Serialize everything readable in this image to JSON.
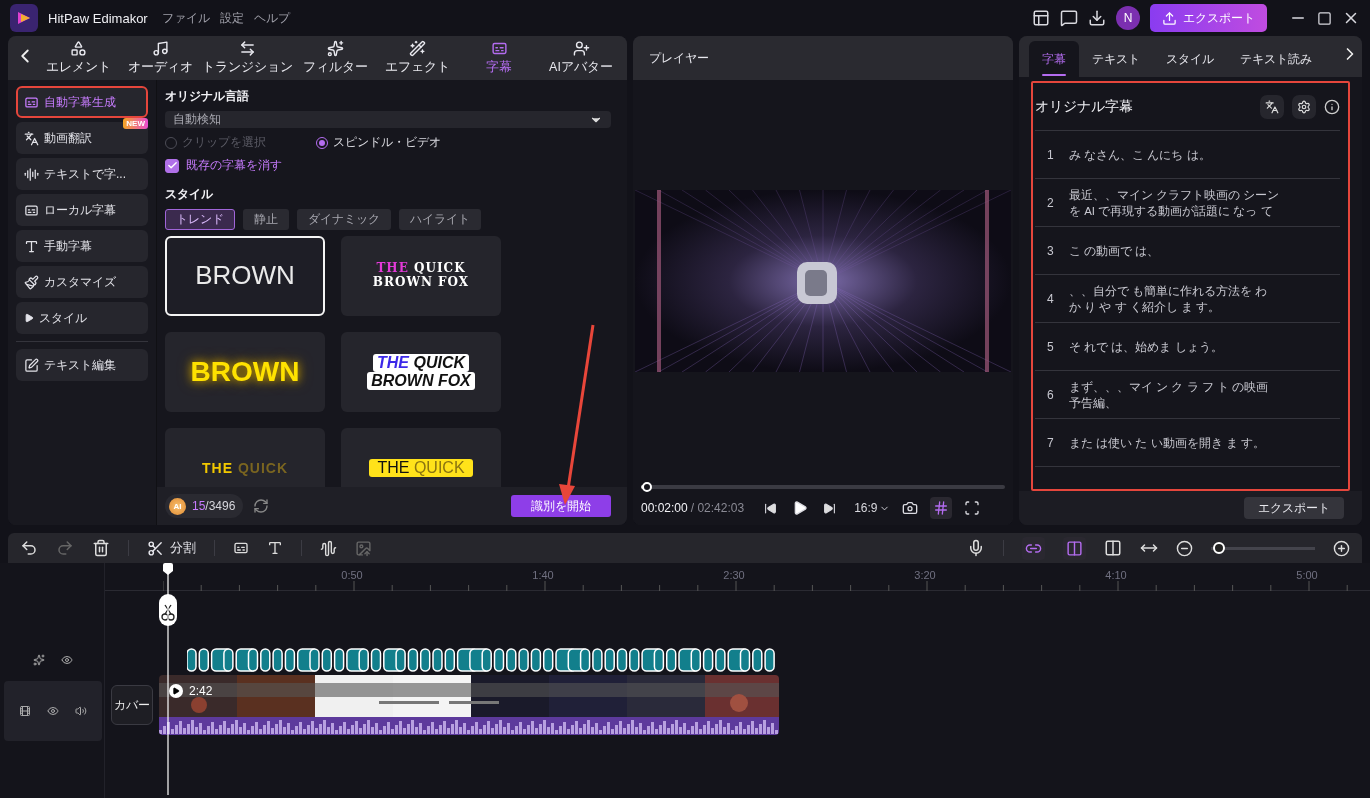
{
  "app": {
    "name": "HitPaw Edimakor",
    "menus": [
      "ファイル",
      "設定",
      "ヘルプ"
    ],
    "avatar": "N",
    "export_label": "エクスポート"
  },
  "categories": [
    {
      "label": "エレメント",
      "selected": false
    },
    {
      "label": "オーディオ",
      "selected": false
    },
    {
      "label": "トランジション",
      "selected": false
    },
    {
      "label": "フィルター",
      "selected": false
    },
    {
      "label": "エフェクト",
      "selected": false
    },
    {
      "label": "字幕",
      "selected": true
    },
    {
      "label": "AIアバター",
      "selected": false
    }
  ],
  "side_items": [
    {
      "label": "自動字幕生成",
      "selected": true,
      "highlighted": true,
      "kind": "item"
    },
    {
      "label": "動画翻訳",
      "selected": false,
      "highlighted": false,
      "kind": "item",
      "badge": "NEW"
    },
    {
      "label": "テキストで字...",
      "selected": false,
      "highlighted": false,
      "kind": "item"
    },
    {
      "label": "ローカル字幕",
      "selected": false,
      "highlighted": false,
      "kind": "item"
    },
    {
      "label": "手動字幕",
      "selected": false,
      "highlighted": false,
      "kind": "item"
    },
    {
      "label": "カスタマイズ",
      "selected": false,
      "highlighted": false,
      "kind": "item"
    },
    {
      "label": "スタイル",
      "selected": false,
      "highlighted": false,
      "kind": "group",
      "expanded": false
    },
    {
      "label": "テキスト編集",
      "selected": false,
      "highlighted": false,
      "kind": "item"
    }
  ],
  "language": {
    "label": "オリジナル言語",
    "value": "自動検知"
  },
  "scope_options": [
    {
      "label": "クリップを選択",
      "selected": false,
      "disabled": true
    },
    {
      "label": "スピンドル・ビデオ",
      "selected": true,
      "disabled": false
    }
  ],
  "clear_existing": {
    "label": "既存の字幕を消す",
    "checked": true
  },
  "style_section": {
    "title": "スタイル",
    "chips": [
      {
        "label": "トレンド",
        "selected": true
      },
      {
        "label": "静止",
        "selected": false
      },
      {
        "label": "ダイナミック",
        "selected": false
      },
      {
        "label": "ハイライト",
        "selected": false
      }
    ],
    "presets": [
      {
        "kind": "plain",
        "selected": true,
        "lines": [
          [
            {
              "text": "BROWN",
              "accent": false
            }
          ]
        ]
      },
      {
        "kind": "impact",
        "selected": false,
        "lines": [
          [
            {
              "text": "THE",
              "accent": true
            },
            {
              "text": "QUICK",
              "accent": false
            }
          ],
          [
            {
              "text": "BROWN FOX",
              "accent": false
            }
          ]
        ]
      },
      {
        "kind": "glow",
        "selected": false,
        "lines": [
          [
            {
              "text": "BROWN",
              "accent": false
            }
          ]
        ]
      },
      {
        "kind": "sticker",
        "selected": false,
        "lines": [
          [
            {
              "text": "THE",
              "accent": true
            },
            {
              "text": "QUICK",
              "accent": false
            }
          ],
          [
            {
              "text": "BROWN FOX",
              "accent": false
            }
          ]
        ]
      },
      {
        "kind": "gold",
        "selected": false,
        "lines": [
          [
            {
              "text": "THE",
              "accent": true
            },
            {
              "text": "QUICK",
              "accent": false
            }
          ]
        ]
      },
      {
        "kind": "banner",
        "selected": false,
        "lines": [
          [
            {
              "text": "THE",
              "accent": true
            },
            {
              "text": "QUICK",
              "accent": false
            }
          ]
        ]
      }
    ]
  },
  "credits": {
    "badge": "AI",
    "used": "15",
    "total": "/3496"
  },
  "start_button": "識別を開始",
  "player": {
    "title": "プレイヤー",
    "current": "00:02:00",
    "separator": "/",
    "total": "02:42:03",
    "ratio": "16:9",
    "level": 0.01
  },
  "subtitle_panel": {
    "tabs": [
      {
        "label": "字幕",
        "selected": true
      },
      {
        "label": "テキスト",
        "selected": false
      },
      {
        "label": "スタイル",
        "selected": false
      },
      {
        "label": "テキスト読み",
        "selected": false
      }
    ],
    "title": "オリジナル字幕",
    "highlighted": true,
    "rows": [
      {
        "number": "1",
        "lines": [
          "み なさん、こ んにち は。"
        ]
      },
      {
        "number": "2",
        "lines": [
          "最近、、マイン クラフト映画の シーン",
          "を AI で再現する動画が話題に なっ て"
        ]
      },
      {
        "number": "3",
        "lines": [
          "こ の動画で は、"
        ]
      },
      {
        "number": "4",
        "lines": [
          "、、自分で も簡単に作れる方法を わ",
          "か り や す く紹介し ま す。"
        ]
      },
      {
        "number": "5",
        "lines": [
          "そ れで は、始めま しょう。"
        ]
      },
      {
        "number": "6",
        "lines": [
          "まず、、、マイ ン ク ラ フ ト の映画",
          "予告編、"
        ]
      },
      {
        "number": "7",
        "lines": [
          "また は使い た い動画を開き ま す。"
        ]
      }
    ],
    "export_label": "エクスポート"
  },
  "timeline": {
    "split_label": "分割",
    "ruler": [
      "0:50",
      "1:40",
      "2:30",
      "3:20",
      "4:10",
      "5:00"
    ],
    "cover_label": "カバー",
    "clip_duration": "2:42",
    "zoom": {
      "level": 0.02
    }
  }
}
